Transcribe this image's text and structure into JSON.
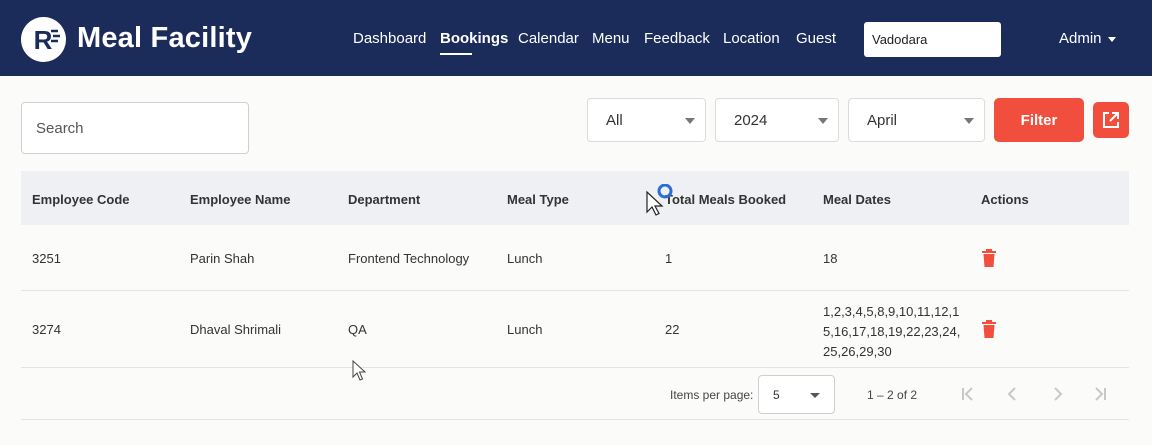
{
  "app": {
    "brand": "Meal Facility",
    "logo_letter": "R"
  },
  "nav": {
    "items": [
      {
        "label": "Dashboard",
        "active": false
      },
      {
        "label": "Bookings",
        "active": true
      },
      {
        "label": "Calendar",
        "active": false
      },
      {
        "label": "Menu",
        "active": false
      },
      {
        "label": "Feedback",
        "active": false
      },
      {
        "label": "Location",
        "active": false
      },
      {
        "label": "Guest",
        "active": false
      }
    ],
    "location_value": "Vadodara",
    "admin_label": "Admin"
  },
  "toolbar": {
    "search_placeholder": "Search",
    "meal_type_filter": "All",
    "year_filter": "2024",
    "month_filter": "April",
    "filter_label": "Filter"
  },
  "table": {
    "columns": [
      "Employee Code",
      "Employee Name",
      "Department",
      "Meal Type",
      "Total Meals Booked",
      "Meal Dates",
      "Actions"
    ],
    "rows": [
      {
        "code": "3251",
        "name": "Parin Shah",
        "department": "Frontend Technology",
        "meal_type": "Lunch",
        "total": "1",
        "dates": "18"
      },
      {
        "code": "3274",
        "name": "Dhaval Shrimali",
        "department": "QA",
        "meal_type": "Lunch",
        "total": "22",
        "dates": "1,2,3,4,5,8,9,10,11,12,15,16,17,18,19,22,23,24,25,26,29,30"
      }
    ]
  },
  "pagination": {
    "items_per_page_label": "Items per page:",
    "items_per_page": "5",
    "range": "1 – 2 of 2"
  },
  "colors": {
    "navbar": "#1b2c5b",
    "accent": "#f24e3d",
    "table_header": "#eef0f3"
  },
  "icons": [
    "logo-icon",
    "caret-down-icon",
    "external-link-icon",
    "trash-icon",
    "first-page-icon",
    "prev-page-icon",
    "next-page-icon",
    "last-page-icon"
  ]
}
